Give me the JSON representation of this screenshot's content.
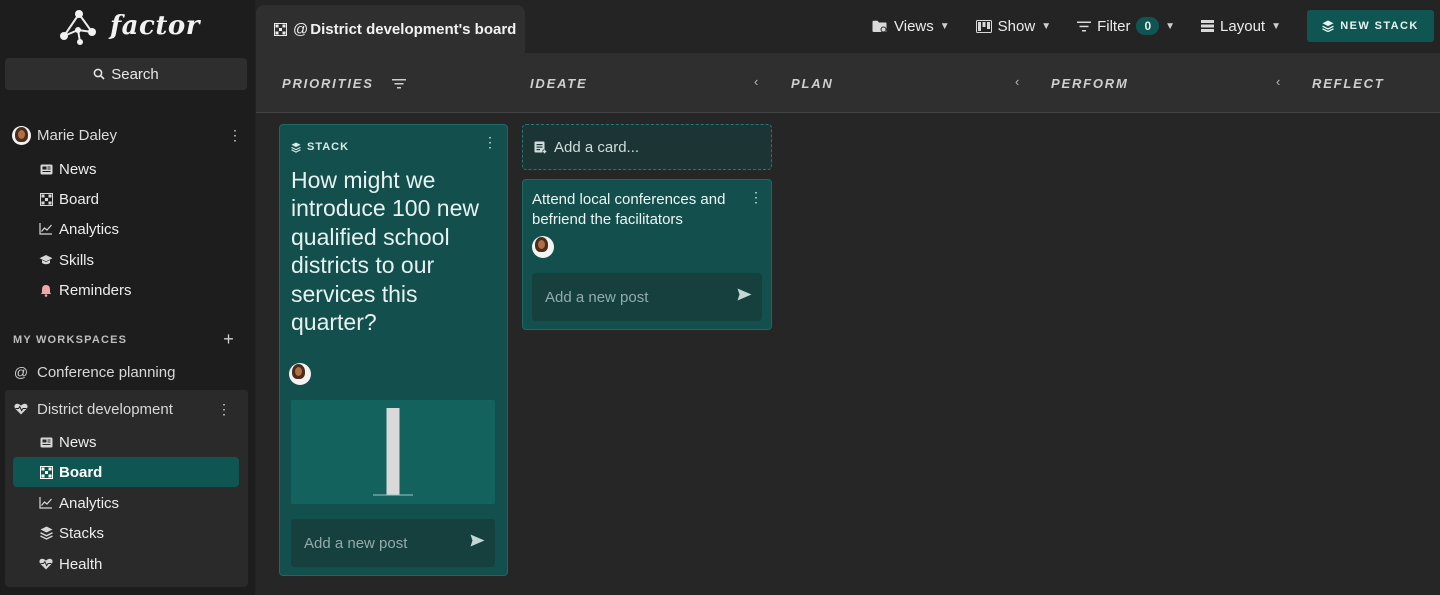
{
  "app": {
    "name": "factor",
    "search_label": "Search"
  },
  "user": {
    "name": "Marie Daley",
    "nav": [
      {
        "label": "News",
        "icon": "newspaper-icon"
      },
      {
        "label": "Board",
        "icon": "board-grid-icon"
      },
      {
        "label": "Analytics",
        "icon": "line-chart-icon"
      },
      {
        "label": "Skills",
        "icon": "graduation-cap-icon"
      },
      {
        "label": "Reminders",
        "icon": "bell-icon"
      }
    ]
  },
  "workspaces": {
    "section_label": "MY WORKSPACES",
    "items": [
      {
        "label": "Conference planning",
        "icon": "at-icon"
      },
      {
        "label": "District development",
        "icon": "heart-pulse-icon"
      }
    ],
    "active_nav": [
      {
        "label": "News",
        "icon": "newspaper-icon"
      },
      {
        "label": "Board",
        "icon": "board-grid-icon",
        "active": true
      },
      {
        "label": "Analytics",
        "icon": "line-chart-icon"
      },
      {
        "label": "Stacks",
        "icon": "layers-icon"
      },
      {
        "label": "Health",
        "icon": "heart-pulse-icon"
      }
    ]
  },
  "header": {
    "tab_title": "District development's board",
    "views_label": "Views",
    "show_label": "Show",
    "filter_label": "Filter",
    "filter_count": "0",
    "layout_label": "Layout",
    "new_stack_label": "NEW STACK"
  },
  "columns": [
    {
      "label": "PRIORITIES"
    },
    {
      "label": "IDEATE"
    },
    {
      "label": "PLAN"
    },
    {
      "label": "PERFORM"
    },
    {
      "label": "REFLECT"
    }
  ],
  "stack": {
    "label": "STACK",
    "title": "How might we introduce 100 new qualified school districts to our services this quarter?",
    "post_placeholder": "Add a new post"
  },
  "ideate": {
    "add_card_label": "Add a card...",
    "card_title": "Attend local conferences and befriend the facilitators",
    "post_placeholder": "Add a new post"
  },
  "colors": {
    "accent": "#0f5653",
    "card": "#124f4d",
    "background": "#242424"
  },
  "chart_data": {
    "type": "bar",
    "categories": [
      ""
    ],
    "values": [
      1
    ],
    "ylim": [
      0,
      1
    ]
  }
}
